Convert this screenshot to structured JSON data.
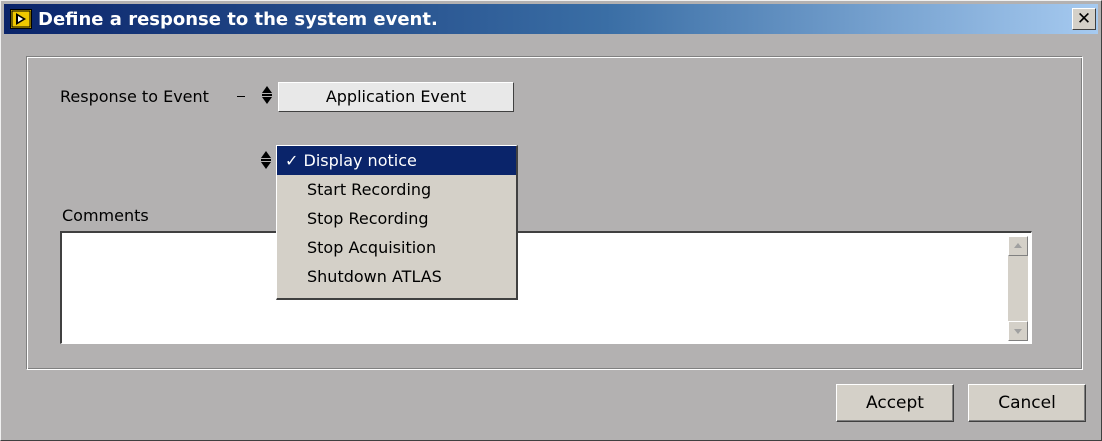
{
  "window": {
    "title": "Define a response to the system event.",
    "close_glyph": "✕",
    "app_icon": "labview-run-icon"
  },
  "group": {
    "label": "Response to Event",
    "event_value": "Application Event"
  },
  "response_menu": {
    "items": [
      {
        "label": "✓ Display notice",
        "selected": true
      },
      {
        "label": "Start Recording",
        "selected": false
      },
      {
        "label": "Stop Recording",
        "selected": false
      },
      {
        "label": "Stop Acquisition",
        "selected": false
      },
      {
        "label": "Shutdown ATLAS",
        "selected": false
      }
    ]
  },
  "comments": {
    "label": "Comments",
    "value": ""
  },
  "buttons": {
    "accept": "Accept",
    "cancel": "Cancel"
  },
  "colors": {
    "title_bar": "#0a246a",
    "selection": "#0a246a",
    "panel": "#b3b1b1"
  }
}
